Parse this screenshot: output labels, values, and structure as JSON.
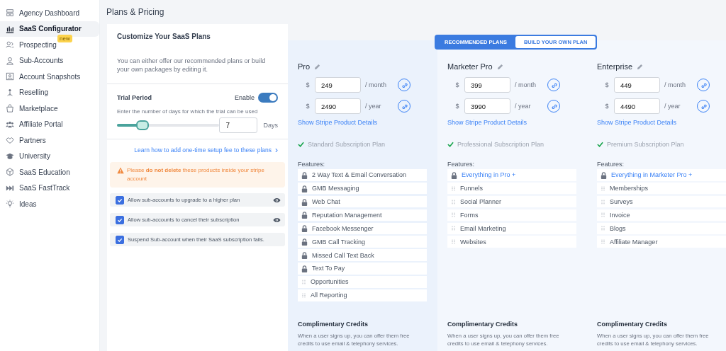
{
  "sidebar": {
    "items": [
      {
        "label": "Agency Dashboard",
        "selected": false
      },
      {
        "label": "SaaS Configurator",
        "selected": true
      },
      {
        "label": "Prospecting",
        "selected": false,
        "badge": "new"
      },
      {
        "label": "Sub-Accounts",
        "selected": false
      },
      {
        "label": "Account Snapshots",
        "selected": false
      },
      {
        "label": "Reselling",
        "selected": false
      },
      {
        "label": "Marketplace",
        "selected": false
      },
      {
        "label": "Affiliate Portal",
        "selected": false
      },
      {
        "label": "Partners",
        "selected": false
      },
      {
        "label": "University",
        "selected": false
      },
      {
        "label": "SaaS Education",
        "selected": false
      },
      {
        "label": "SaaS FastTrack",
        "selected": false
      },
      {
        "label": "Ideas",
        "selected": false
      }
    ]
  },
  "header": {
    "title": "Plans & Pricing"
  },
  "settings": {
    "title": "Customize Your SaaS Plans",
    "description": "You can either offer our recommended plans or build your own packages by editing it.",
    "trial": {
      "label": "Trial Period",
      "toggle_label": "Enable",
      "on": true,
      "hint": "Enter the number of days for which the trial can be used",
      "level": 0.25,
      "days": "7",
      "unit": "Days"
    },
    "link": "Learn how to add one-time setup fee to these plans",
    "link_icon": "›",
    "warning": "Please **do not delete** these products inside your stripe account",
    "options": [
      {
        "label": "Allow sub-accounts to upgrade to a higher plan",
        "checked": true,
        "visible": true
      },
      {
        "label": "Allow sub-accounts to cancel their subscription",
        "checked": true,
        "visible": true
      },
      {
        "label": "Suspend Sub-account when their SaaS subscription fails.",
        "checked": true,
        "visible": false
      }
    ]
  },
  "plan_tabs": [
    {
      "label": "RECOMMENDED PLANS",
      "selected": true
    },
    {
      "label": "BUILD YOUR OWN PLAN",
      "selected": false
    }
  ],
  "plans": [
    {
      "name": "Pro",
      "currency": "$",
      "monthly": "249",
      "month_unit": "/ month",
      "yearly": "2490",
      "year_unit": "/ year",
      "details_link": "Show Stripe Product Details",
      "plan_type": "Standard Subscription Plan",
      "features_label": "Features:",
      "features": [
        {
          "label": "2 Way Text & Email Conversation",
          "kind": "locked"
        },
        {
          "label": "GMB Messaging",
          "kind": "locked"
        },
        {
          "label": "Web Chat",
          "kind": "locked"
        },
        {
          "label": "Reputation Management",
          "kind": "locked"
        },
        {
          "label": "Facebook Messenger",
          "kind": "locked"
        },
        {
          "label": "GMB Call Tracking",
          "kind": "locked"
        },
        {
          "label": "Missed Call Text Back",
          "kind": "locked"
        },
        {
          "label": "Text To Pay",
          "kind": "locked"
        },
        {
          "label": "Opportunities",
          "kind": "draggable"
        },
        {
          "label": "All Reporting",
          "kind": "draggable"
        }
      ],
      "credits_title": "Complimentary Credits",
      "credits_text": "When a user signs up, you can offer them free credits to use email & telephony services."
    },
    {
      "name": "Marketer Pro",
      "currency": "$",
      "monthly": "399",
      "month_unit": "/ month",
      "yearly": "3990",
      "year_unit": "/ year",
      "details_link": "Show Stripe Product Details",
      "plan_type": "Professional Subscription Plan",
      "features_label": "Features:",
      "features": [
        {
          "label": "Everything in Pro +",
          "kind": "inherited"
        },
        {
          "label": "Funnels",
          "kind": "draggable"
        },
        {
          "label": "Social Planner",
          "kind": "draggable"
        },
        {
          "label": "Forms",
          "kind": "draggable"
        },
        {
          "label": "Email Marketing",
          "kind": "draggable"
        },
        {
          "label": "Websites",
          "kind": "draggable"
        }
      ],
      "credits_title": "Complimentary Credits",
      "credits_text": "When a user signs up, you can offer them free credits to use email & telephony services."
    },
    {
      "name": "Enterprise",
      "currency": "$",
      "monthly": "449",
      "month_unit": "/ month",
      "yearly": "4490",
      "year_unit": "/ year",
      "details_link": "Show Stripe Product Details",
      "plan_type": "Premium Subscription Plan",
      "features_label": "Features:",
      "features": [
        {
          "label": "Everything in Marketer Pro +",
          "kind": "inherited"
        },
        {
          "label": "Memberships",
          "kind": "draggable"
        },
        {
          "label": "Surveys",
          "kind": "draggable"
        },
        {
          "label": "Invoice",
          "kind": "draggable"
        },
        {
          "label": "Blogs",
          "kind": "draggable"
        },
        {
          "label": "Affiliate Manager",
          "kind": "draggable"
        }
      ],
      "credits_title": "Complimentary Credits",
      "credits_text": "When a user signs up, you can offer them free credits to use email & telephony services."
    }
  ]
}
